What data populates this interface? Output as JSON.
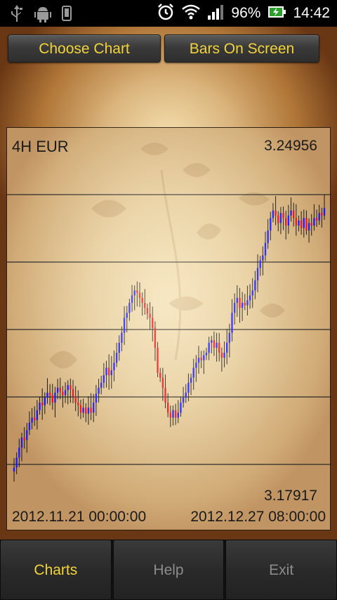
{
  "status_bar": {
    "battery": "96%",
    "time": "14:42",
    "icons": [
      "usb-icon",
      "android-icon",
      "phone-icon",
      "alarm-icon",
      "wifi-icon",
      "signal-icon",
      "battery-charging-icon"
    ]
  },
  "toolbar": {
    "choose_chart_label": "Choose Chart",
    "bars_on_screen_label": "Bars On Screen"
  },
  "chart": {
    "title": "4H EUR",
    "price_high": "3.24956",
    "price_low": "3.17917",
    "date_start": "2012.11.21 00:00:00",
    "date_end": "2012.12.27 08:00:00"
  },
  "chart_data": {
    "type": "candlestick",
    "title": "4H EUR",
    "ylim": [
      3.17917,
      3.24956
    ],
    "x_start": "2012.11.21 00:00:00",
    "x_end": "2012.12.27 08:00:00",
    "up_color": "#1a1aff",
    "down_color": "#e8141c",
    "wick_color": "#1a1a1a",
    "gridlines": true,
    "close": [
      3.186,
      3.188,
      3.19,
      3.192,
      3.1915,
      3.1935,
      3.195,
      3.196,
      3.1955,
      3.1975,
      3.199,
      3.1985,
      3.2,
      3.201,
      3.2005,
      3.199,
      3.201,
      3.202,
      3.2012,
      3.2005,
      3.2015,
      3.2025,
      3.2017,
      3.2002,
      3.199,
      3.1985,
      3.197,
      3.198,
      3.1968,
      3.198,
      3.197,
      3.199,
      3.2008,
      3.202,
      3.203,
      3.2045,
      3.206,
      3.2045,
      3.2055,
      3.207,
      3.209,
      3.211,
      3.213,
      3.216,
      3.217,
      3.219,
      3.2205,
      3.2215,
      3.221,
      3.22,
      3.219,
      3.218,
      3.2168,
      3.216,
      3.214,
      3.21,
      3.205,
      3.204,
      3.202,
      3.199,
      3.197,
      3.196,
      3.1975,
      3.196,
      3.197,
      3.199,
      3.2,
      3.201,
      3.203,
      3.204,
      3.206,
      3.207,
      3.208,
      3.2075,
      3.2085,
      3.209,
      3.211,
      3.2115,
      3.21,
      3.211,
      3.209,
      3.208,
      3.209,
      3.211,
      3.213,
      3.217,
      3.219,
      3.22,
      3.218,
      3.219,
      3.2185,
      3.2195,
      3.2205,
      3.2215,
      3.2235,
      3.226,
      3.2275,
      3.2285,
      3.231,
      3.2335,
      3.236,
      3.2375,
      3.2365,
      3.235,
      3.237,
      3.236,
      3.2345,
      3.2365,
      3.2375,
      3.236,
      3.2345,
      3.2355,
      3.234,
      3.236,
      3.2335,
      3.235,
      3.2345,
      3.236,
      3.2355,
      3.237,
      3.2365,
      3.238
    ]
  },
  "nav": {
    "charts_label": "Charts",
    "help_label": "Help",
    "exit_label": "Exit"
  }
}
